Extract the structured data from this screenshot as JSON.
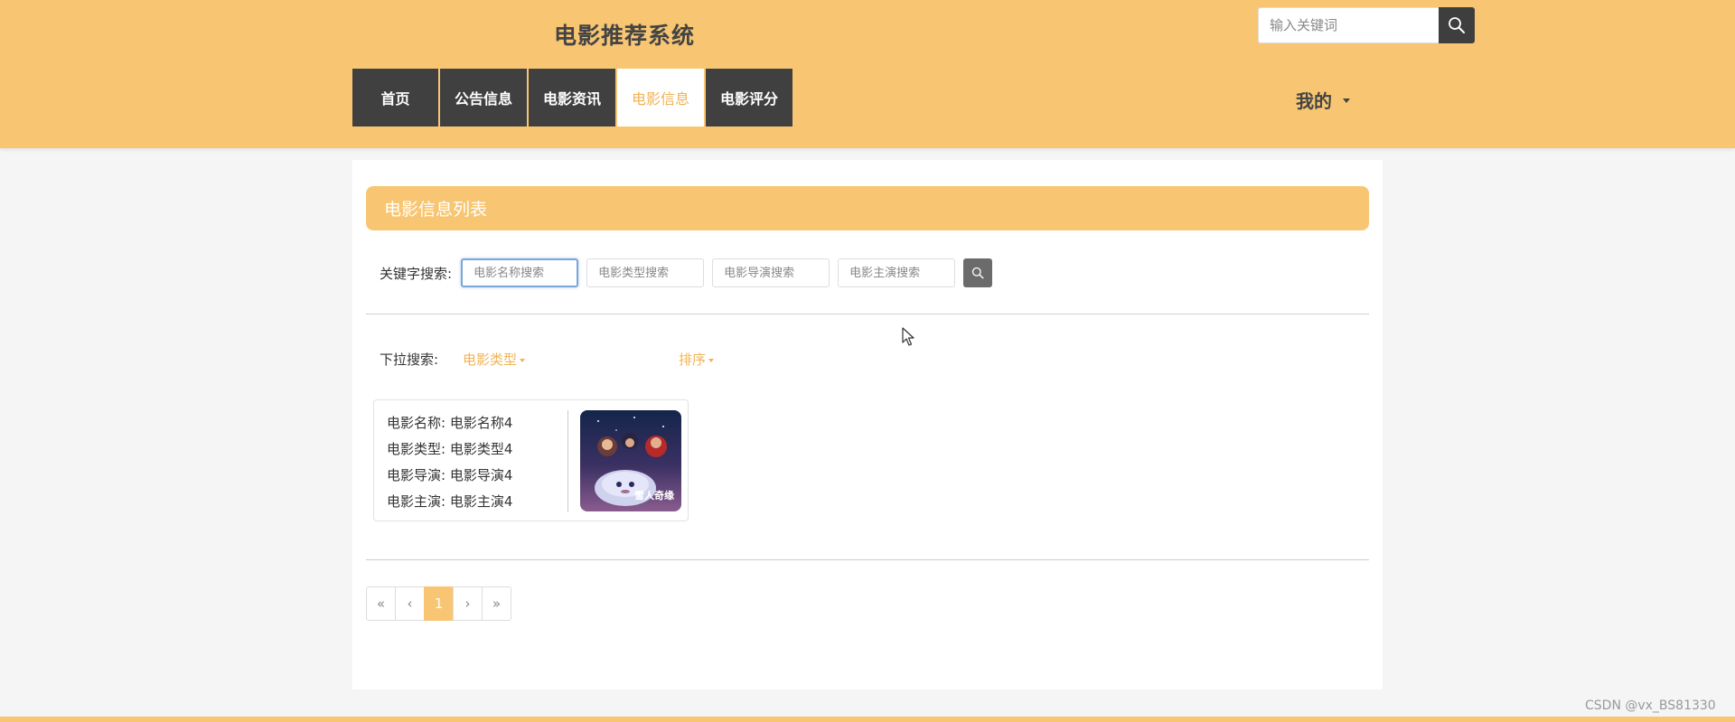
{
  "header": {
    "site_title": "电影推荐系统",
    "search_placeholder": "输入关键词"
  },
  "nav": {
    "items": [
      {
        "label": "首页",
        "active": false
      },
      {
        "label": "公告信息",
        "active": false
      },
      {
        "label": "电影资讯",
        "active": false
      },
      {
        "label": "电影信息",
        "active": true
      },
      {
        "label": "电影评分",
        "active": false
      }
    ],
    "user_menu": "我的"
  },
  "main": {
    "panel_title": "电影信息列表",
    "keyword_label": "关键字搜索:",
    "keyword_inputs": [
      {
        "placeholder": "电影名称搜索"
      },
      {
        "placeholder": "电影类型搜索"
      },
      {
        "placeholder": "电影导演搜索"
      },
      {
        "placeholder": "电影主演搜索"
      }
    ],
    "dropdown_label": "下拉搜索:",
    "dropdowns": [
      {
        "label": "电影类型"
      },
      {
        "label": "排序"
      }
    ],
    "movies": [
      {
        "name": "电影名称: 电影名称4",
        "type": "电影类型: 电影类型4",
        "director": "电影导演: 电影导演4",
        "actor": "电影主演: 电影主演4",
        "poster_text": "雪人奇缘"
      }
    ],
    "pagination": {
      "first": "«",
      "prev": "‹",
      "current": "1",
      "next": "›",
      "last": "»"
    }
  },
  "footer": {
    "watermark": "CSDN @vx_BS81330"
  },
  "colors": {
    "accent": "#f8c672",
    "accent_text": "#f0b356",
    "nav_dark": "#404040"
  },
  "icons": {
    "top_search": "search-icon",
    "keyword_search": "search-icon",
    "dropdown": "caret-down-icon"
  }
}
